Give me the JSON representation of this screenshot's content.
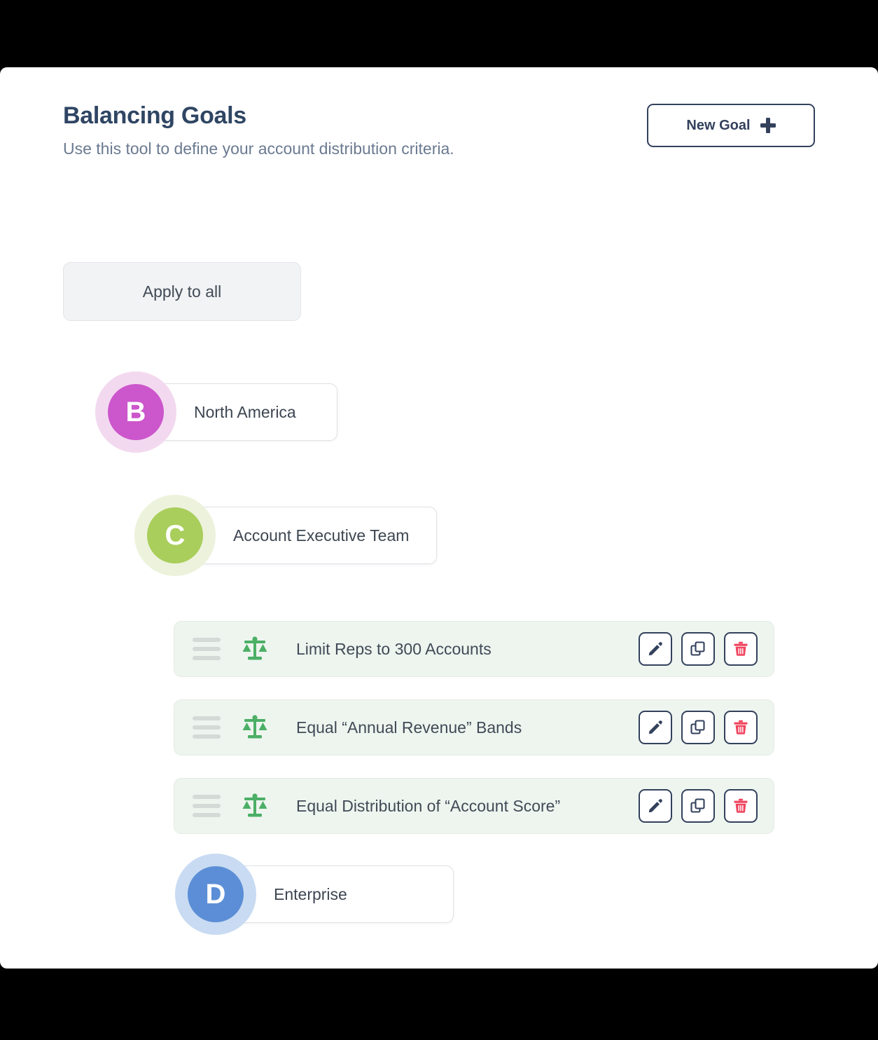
{
  "header": {
    "title": "Balancing Goals",
    "subtitle": "Use this tool to define your account distribution criteria.",
    "new_goal_label": "New Goal",
    "new_goal_icon": "plus-icon"
  },
  "toolbar": {
    "apply_to_all_label": "Apply to all"
  },
  "tree": {
    "nodes": [
      {
        "badge_letter": "B",
        "label": "North America",
        "disc_color": "#cc56cc",
        "ring_color": "#f3d9f0"
      },
      {
        "badge_letter": "C",
        "label": "Account Executive Team",
        "disc_color": "#a9ce5b",
        "ring_color": "#edf2dc"
      },
      {
        "badge_letter": "D",
        "label": "Enterprise",
        "disc_color": "#5b8ed6",
        "ring_color": "#c8dbf2"
      }
    ]
  },
  "goals": {
    "row_background": "#eef5ef",
    "scale_icon_color": "#4caf66",
    "items": [
      {
        "icon": "balance-scale-icon",
        "title": "Limit Reps to 300 Accounts",
        "actions": [
          "edit-pencil-icon",
          "duplicate-icon",
          "delete-trash-icon"
        ]
      },
      {
        "icon": "balance-scale-icon",
        "title": "Equal “Annual Revenue” Bands",
        "actions": [
          "edit-pencil-icon",
          "duplicate-icon",
          "delete-trash-icon"
        ]
      },
      {
        "icon": "balance-scale-icon",
        "title": "Equal Distribution of “Account Score”",
        "actions": [
          "edit-pencil-icon",
          "duplicate-icon",
          "delete-trash-icon"
        ]
      }
    ]
  },
  "colors": {
    "title_navy": "#2f4563",
    "subtitle_slate": "#6b7a90",
    "outline_navy": "#33415c",
    "danger_red": "#f0445e",
    "goal_green": "#4caf66"
  }
}
